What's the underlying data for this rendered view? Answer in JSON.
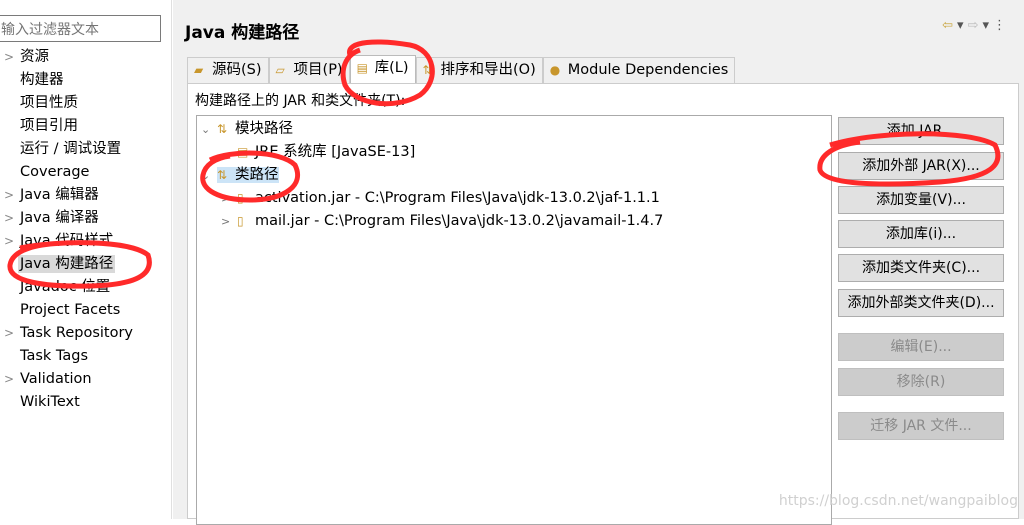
{
  "filter": {
    "placeholder": "输入过滤器文本"
  },
  "sidebar": {
    "items": [
      {
        "label": "资源",
        "expandable": true
      },
      {
        "label": "构建器",
        "expandable": false
      },
      {
        "label": "项目性质",
        "expandable": false
      },
      {
        "label": "项目引用",
        "expandable": false
      },
      {
        "label": "运行 / 调试设置",
        "expandable": false
      },
      {
        "label": "Coverage",
        "expandable": false
      },
      {
        "label": "Java 编辑器",
        "expandable": true
      },
      {
        "label": "Java 编译器",
        "expandable": true
      },
      {
        "label": "Java 代码样式",
        "expandable": true
      },
      {
        "label": "Java 构建路径",
        "expandable": false,
        "selected": true
      },
      {
        "label": "Javadoc 位置",
        "expandable": false
      },
      {
        "label": "Project Facets",
        "expandable": false
      },
      {
        "label": "Task Repository",
        "expandable": true
      },
      {
        "label": "Task Tags",
        "expandable": false
      },
      {
        "label": "Validation",
        "expandable": true
      },
      {
        "label": "WikiText",
        "expandable": false
      }
    ]
  },
  "header": {
    "title": "Java 构建路径"
  },
  "tabs": [
    {
      "label": "源码(S)",
      "icon": "source-folder-icon"
    },
    {
      "label": "项目(P)",
      "icon": "project-folder-icon"
    },
    {
      "label": "库(L)",
      "icon": "library-icon",
      "active": true
    },
    {
      "label": "排序和导出(O)",
      "icon": "order-export-icon"
    },
    {
      "label": "Module Dependencies",
      "icon": "module-icon"
    }
  ],
  "panel": {
    "label": "构建路径上的 JAR 和类文件夹(T):"
  },
  "tree": [
    {
      "label": "模块路径",
      "level": 0,
      "expanded": true,
      "icon": "path-icon"
    },
    {
      "label": "JRE 系统库 [JavaSE-13]",
      "level": 1,
      "icon": "library-icon"
    },
    {
      "label": "类路径",
      "level": 0,
      "expanded": true,
      "icon": "path-icon",
      "selected": true
    },
    {
      "label": "activation.jar  -  C:\\Program Files\\Java\\jdk-13.0.2\\jaf-1.1.1",
      "level": 1,
      "icon": "jar-icon",
      "expandable": true
    },
    {
      "label": "mail.jar  -  C:\\Program Files\\Java\\jdk-13.0.2\\javamail-1.4.7",
      "level": 1,
      "icon": "jar-icon",
      "expandable": true
    }
  ],
  "buttons": [
    {
      "label": "添加 JAR...",
      "enabled": true
    },
    {
      "label": "添加外部 JAR(X)...",
      "enabled": true
    },
    {
      "label": "添加变量(V)...",
      "enabled": true
    },
    {
      "label": "添加库(i)...",
      "enabled": true
    },
    {
      "label": "添加类文件夹(C)...",
      "enabled": true
    },
    {
      "label": "添加外部类文件夹(D)...",
      "enabled": true
    },
    {
      "label": "编辑(E)...",
      "enabled": false
    },
    {
      "label": "移除(R)",
      "enabled": false
    },
    {
      "label": "迁移 JAR 文件...",
      "enabled": false
    }
  ],
  "watermark": "https://blog.csdn.net/wangpaiblog",
  "colors": {
    "annotation": "#ff2a2a",
    "selection": "#cce4f7"
  }
}
